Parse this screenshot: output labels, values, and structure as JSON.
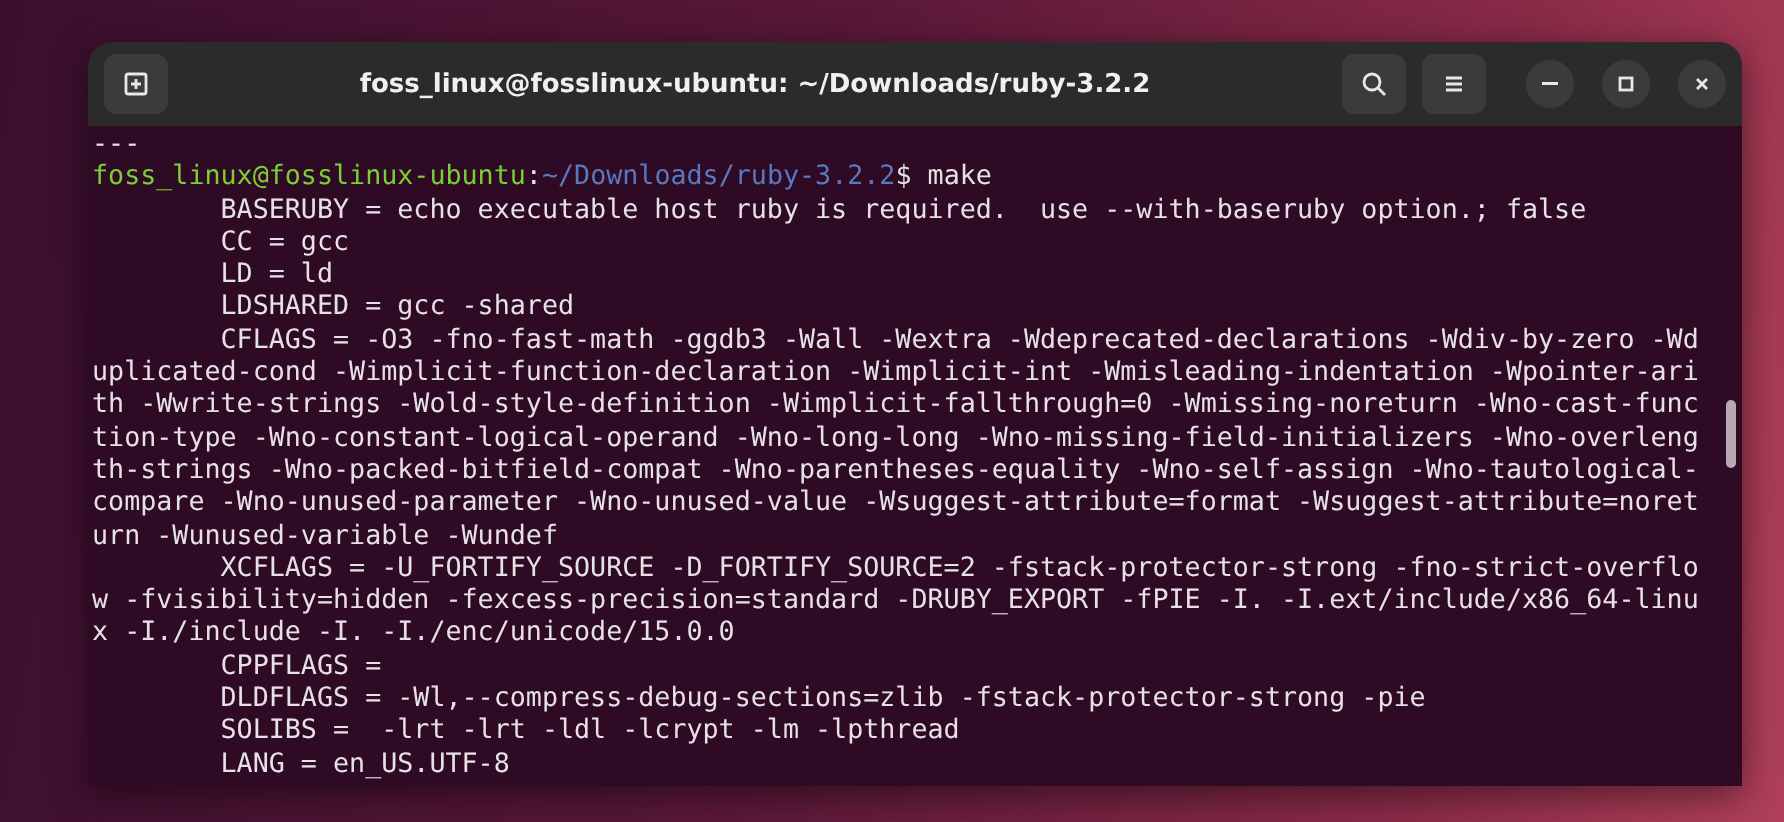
{
  "window": {
    "title": "foss_linux@fosslinux-ubuntu: ~/Downloads/ruby-3.2.2"
  },
  "lines": [
    {
      "kind": "output",
      "text": "---"
    },
    {
      "kind": "prompt",
      "user_host": "foss_linux@fosslinux-ubuntu",
      "separator": ":",
      "path": "~/Downloads/ruby-3.2.2",
      "symbol": "$",
      "command": " make"
    },
    {
      "kind": "output",
      "text": "        BASERUBY = echo executable host ruby is required.  use --with-baseruby option.; false"
    },
    {
      "kind": "output",
      "text": "        CC = gcc"
    },
    {
      "kind": "output",
      "text": "        LD = ld"
    },
    {
      "kind": "output",
      "text": "        LDSHARED = gcc -shared"
    },
    {
      "kind": "output",
      "text": "        CFLAGS = -O3 -fno-fast-math -ggdb3 -Wall -Wextra -Wdeprecated-declarations -Wdiv-by-zero -Wd"
    },
    {
      "kind": "output",
      "text": "uplicated-cond -Wimplicit-function-declaration -Wimplicit-int -Wmisleading-indentation -Wpointer-ari"
    },
    {
      "kind": "output",
      "text": "th -Wwrite-strings -Wold-style-definition -Wimplicit-fallthrough=0 -Wmissing-noreturn -Wno-cast-func"
    },
    {
      "kind": "output",
      "text": "tion-type -Wno-constant-logical-operand -Wno-long-long -Wno-missing-field-initializers -Wno-overleng"
    },
    {
      "kind": "output",
      "text": "th-strings -Wno-packed-bitfield-compat -Wno-parentheses-equality -Wno-self-assign -Wno-tautological-"
    },
    {
      "kind": "output",
      "text": "compare -Wno-unused-parameter -Wno-unused-value -Wsuggest-attribute=format -Wsuggest-attribute=noret"
    },
    {
      "kind": "output",
      "text": "urn -Wunused-variable -Wundef"
    },
    {
      "kind": "output",
      "text": "        XCFLAGS = -U_FORTIFY_SOURCE -D_FORTIFY_SOURCE=2 -fstack-protector-strong -fno-strict-overflo"
    },
    {
      "kind": "output",
      "text": "w -fvisibility=hidden -fexcess-precision=standard -DRUBY_EXPORT -fPIE -I. -I.ext/include/x86_64-linu"
    },
    {
      "kind": "output",
      "text": "x -I./include -I. -I./enc/unicode/15.0.0"
    },
    {
      "kind": "output",
      "text": "        CPPFLAGS ="
    },
    {
      "kind": "output",
      "text": "        DLDFLAGS = -Wl,--compress-debug-sections=zlib -fstack-protector-strong -pie"
    },
    {
      "kind": "output",
      "text": "        SOLIBS =  -lrt -lrt -ldl -lcrypt -lm -lpthread"
    },
    {
      "kind": "output",
      "text": "        LANG = en_US.UTF-8"
    }
  ]
}
